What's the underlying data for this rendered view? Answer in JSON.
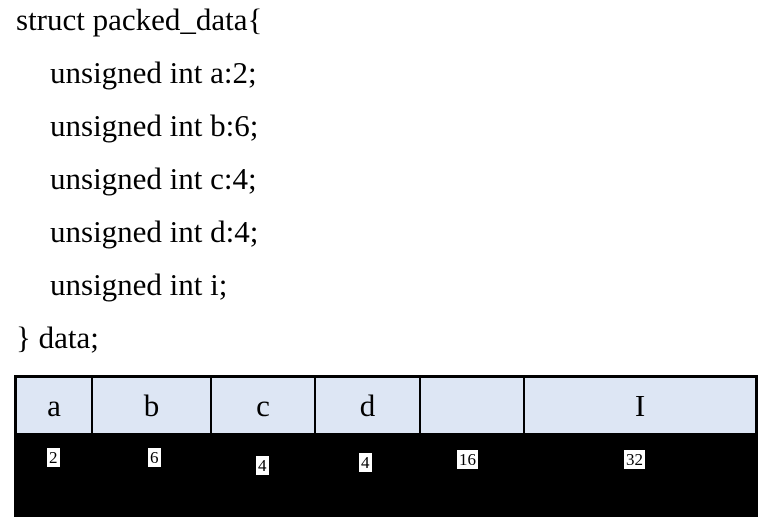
{
  "code": {
    "line0": "struct packed_data{",
    "line1": "unsigned int a:2;",
    "line2": "unsigned int b:6;",
    "line3": "unsigned int c:4;",
    "line4": "unsigned int d:4;",
    "line5": "unsigned int i;",
    "line6": "} data;"
  },
  "layout_fields": [
    {
      "name": "a",
      "bits": "2"
    },
    {
      "name": "b",
      "bits": "6"
    },
    {
      "name": "c",
      "bits": "4"
    },
    {
      "name": "d",
      "bits": "4"
    },
    {
      "name": "",
      "bits": "16"
    },
    {
      "name": "I",
      "bits": "32"
    }
  ],
  "colors": {
    "header_fill": "#dde6f4",
    "bar_fill": "#000000",
    "text": "#000000"
  }
}
